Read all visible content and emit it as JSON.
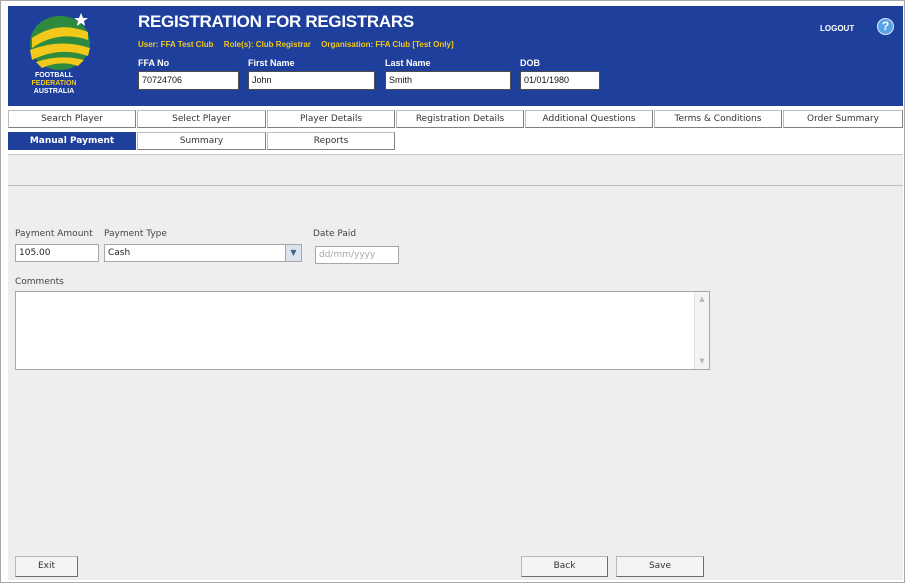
{
  "header": {
    "logo": {
      "line1": "FOOTBALL",
      "line2": "FEDERATION",
      "line3": "AUSTRALIA"
    },
    "title": "REGISTRATION FOR REGISTRARS",
    "user": "User: FFA Test Club",
    "roles": "Role(s): Club Registrar",
    "organisation": "Organisation: FFA Club [Test Only]",
    "logout": "LOGOUT",
    "help": "?",
    "fields": {
      "ffa_no": {
        "label": "FFA No",
        "value": "70724706"
      },
      "first_name": {
        "label": "First Name",
        "value": "John"
      },
      "last_name": {
        "label": "Last Name",
        "value": "Smith"
      },
      "dob": {
        "label": "DOB",
        "value": "01/01/1980"
      }
    }
  },
  "tabs": {
    "row1": [
      "Search Player",
      "Select Player",
      "Player Details",
      "Registration Details",
      "Additional Questions",
      "Terms & Conditions",
      "Order Summary"
    ],
    "row2": [
      "Manual Payment",
      "Summary",
      "Reports"
    ],
    "active": "Manual Payment"
  },
  "form": {
    "payment_amount": {
      "label": "Payment Amount",
      "value": "105.00"
    },
    "payment_type": {
      "label": "Payment Type",
      "value": "Cash"
    },
    "date_paid": {
      "label": "Date Paid",
      "placeholder": "dd/mm/yyyy"
    },
    "comments": {
      "label": "Comments",
      "value": ""
    }
  },
  "buttons": {
    "exit": "Exit",
    "back": "Back",
    "save": "Save"
  },
  "colors": {
    "header_bg": "#1f3f9c",
    "accent_gold": "#f2c81a",
    "panel_bg": "#eeeeee"
  }
}
